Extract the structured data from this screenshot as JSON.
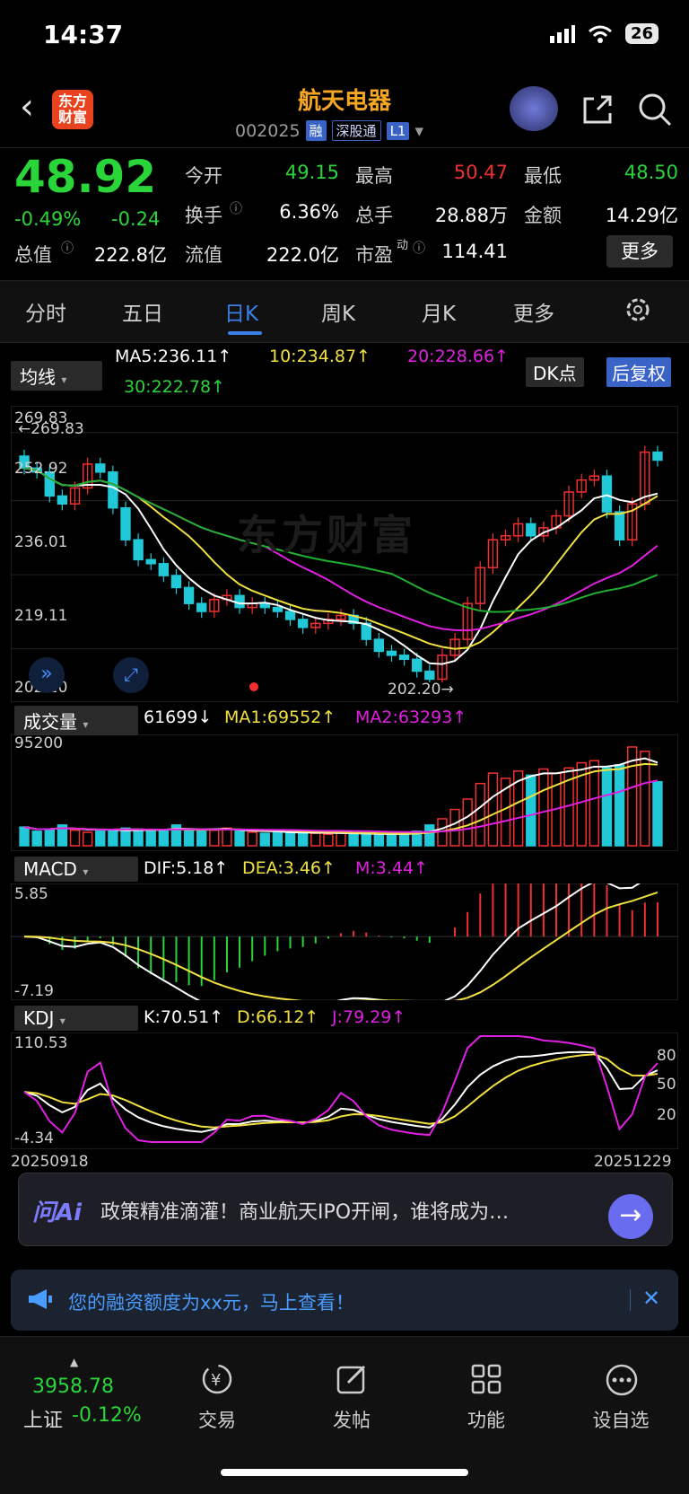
{
  "status": {
    "time": "14:37",
    "battery": "26"
  },
  "header": {
    "title": "航天电器",
    "code": "002025",
    "tag_rong": "融",
    "tag_sgt": "深股通",
    "tag_level": "L1",
    "logo_text": "东方财富"
  },
  "quote": {
    "price": "48.92",
    "change_pct": "-0.49%",
    "change": "-0.24",
    "open_label": "今开",
    "open": "49.15",
    "high_label": "最高",
    "high": "50.47",
    "low_label": "最低",
    "low": "48.50",
    "turnover_label": "换手",
    "turnover": "6.36%",
    "volume_label": "总手",
    "volume": "28.88万",
    "amount_label": "金额",
    "amount": "14.29亿",
    "mktcap_label": "总值",
    "mktcap": "222.8亿",
    "float_label": "流值",
    "float": "222.0亿",
    "pe_label": "市盈",
    "pe_sup": "动",
    "pe": "114.41",
    "more": "更多"
  },
  "tabs": [
    "分时",
    "五日",
    "日K",
    "周K",
    "月K",
    "更多"
  ],
  "kline": {
    "ma_select": "均线",
    "ma5": "MA5:236.11↑",
    "ma10": "10:234.87↑",
    "ma20": "20:228.66↑",
    "ma30": "30:222.78↑",
    "dk_btn": "DK点",
    "fq_btn": "后复权",
    "y_labels": [
      "269.83",
      "252.92",
      "236.01",
      "219.11",
      "202.20"
    ],
    "high_marker": "←269.83",
    "low_marker": "202.20→"
  },
  "volume": {
    "select": "成交量",
    "val": "61699↓",
    "ma1": "MA1:69552↑",
    "ma2": "MA2:63293↑",
    "y_top": "95200"
  },
  "macd": {
    "select": "MACD",
    "dif": "DIF:5.18↑",
    "dea": "DEA:3.46↑",
    "m": "M:3.44↑",
    "y_top": "5.85",
    "y_bottom": "-7.19"
  },
  "kdj": {
    "select": "KDJ",
    "k": "K:70.51↑",
    "d": "D:66.12↑",
    "j": "J:79.29↑",
    "y_top": "110.53",
    "y_bottom": "-4.34",
    "r80": "80",
    "r50": "50",
    "r20": "20"
  },
  "dates": {
    "start": "20250918",
    "end": "20251229"
  },
  "watermark": "东方财富",
  "news": {
    "logo": "问Ai",
    "text": "政策精准滴灌！商业航天IPO开闸，谁将成为…"
  },
  "promo": {
    "text": "您的融资额度为xx元，马上查看！"
  },
  "bottom": {
    "index_val": "3958.78",
    "index_name": "上证",
    "index_chg": "-0.12%",
    "nav": [
      "交易",
      "发帖",
      "功能",
      "设自选"
    ]
  },
  "chart_data": [
    {
      "type": "candlestick",
      "title": "日K",
      "y_range": [
        202.2,
        269.83
      ],
      "close": [
        256,
        255,
        249,
        247,
        251,
        257,
        255,
        246,
        238,
        233,
        232,
        229,
        226,
        222,
        220,
        223,
        224,
        221,
        222,
        221,
        220,
        218,
        216,
        217,
        218,
        219,
        217,
        213,
        210,
        209,
        208,
        205,
        203,
        209,
        213,
        222,
        231,
        238,
        239,
        242,
        239,
        241,
        244,
        250,
        253,
        254,
        245,
        238,
        247,
        260,
        258
      ],
      "series": [
        {
          "name": "MA5",
          "last": 236.11
        },
        {
          "name": "10",
          "last": 234.87
        },
        {
          "name": "20",
          "last": 228.66
        },
        {
          "name": "30",
          "last": 222.78
        }
      ]
    },
    {
      "type": "bar",
      "title": "成交量",
      "y_max": 95200,
      "values": [
        18000,
        14000,
        16000,
        20000,
        15000,
        13000,
        14000,
        15000,
        17000,
        16000,
        14000,
        15000,
        20000,
        16000,
        14000,
        15000,
        17000,
        14000,
        13000,
        12000,
        14000,
        12000,
        13000,
        12000,
        11000,
        13000,
        11000,
        12000,
        10000,
        11000,
        12000,
        14000,
        20000,
        26000,
        35000,
        45000,
        60000,
        70000,
        65000,
        72000,
        68000,
        74000,
        70000,
        75000,
        80000,
        82000,
        75000,
        78000,
        95200,
        91000,
        61699
      ]
    },
    {
      "type": "bar",
      "title": "MACD",
      "y_range": [
        -7.19,
        5.85
      ],
      "last_dif": 5.18,
      "last_dea": 3.46,
      "last_m": 3.44
    },
    {
      "type": "line",
      "title": "KDJ",
      "y_range": [
        -4.34,
        110.53
      ],
      "last_k": 70.51,
      "last_d": 66.12,
      "last_j": 79.29
    }
  ]
}
